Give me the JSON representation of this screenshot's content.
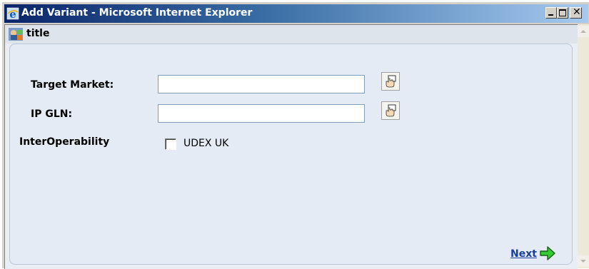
{
  "window": {
    "title": "Add Variant - Microsoft Internet Explorer"
  },
  "header": {
    "title": "title"
  },
  "form": {
    "target_market_label": "Target Market:",
    "target_market_value": "",
    "ip_gln_label": "IP GLN:",
    "ip_gln_value": "",
    "interoperability_label": "InterOperability",
    "udex_uk_label": "UDEX UK",
    "udex_uk_checked": false
  },
  "footer": {
    "next_label": "Next"
  },
  "colors": {
    "link": "#1a3f9a",
    "next_arrow": "#33cc33",
    "title_bar_start": "#0a246a"
  }
}
